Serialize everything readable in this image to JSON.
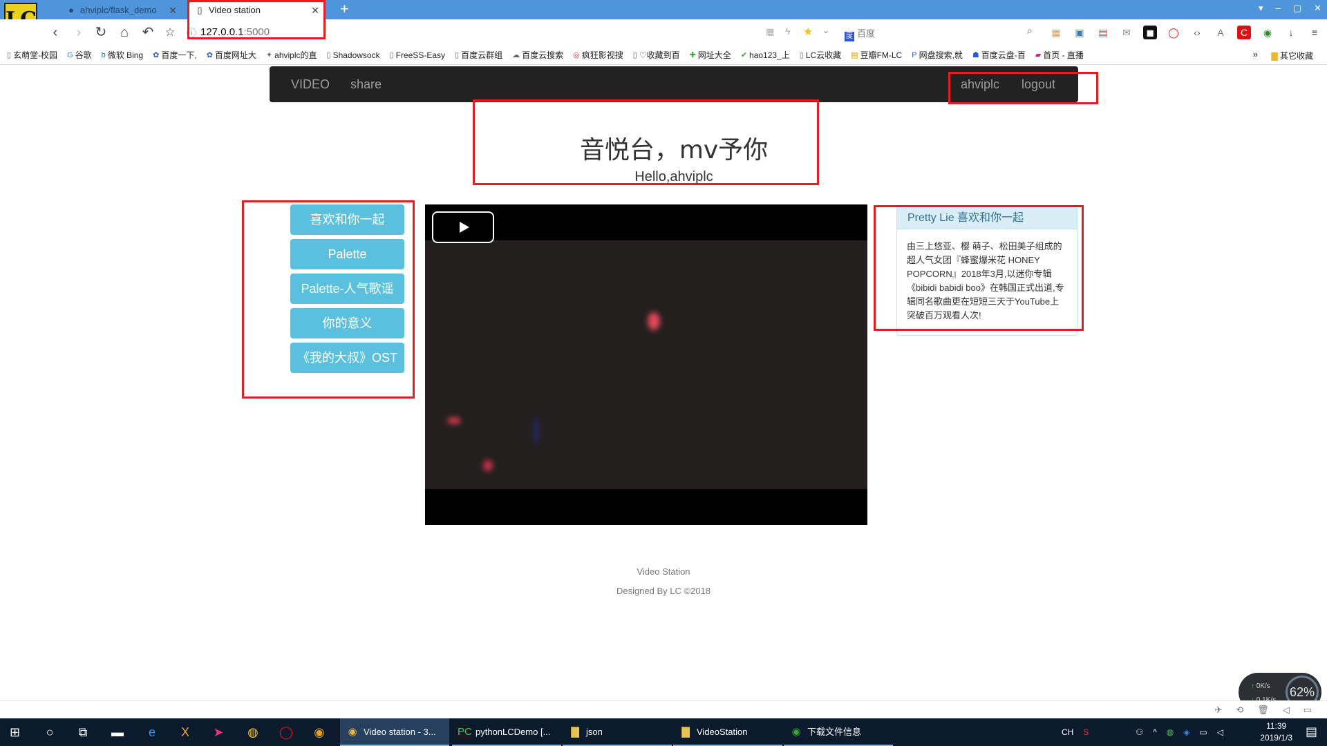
{
  "browser": {
    "tabs": [
      {
        "title": "ahviplc/flask_demo",
        "icon": "github-icon",
        "active": false
      },
      {
        "title": "Video station",
        "icon": "page-icon",
        "active": true
      }
    ],
    "new_tab": "+",
    "url_host": "127.0.0.1",
    "url_port": ":5000",
    "search_engine": "百度",
    "bookmarks": [
      "玄萌堂-校园",
      "谷歌",
      "微软 Bing",
      "百度一下,",
      "百度网址大",
      "ahviplc的直",
      "Shadowsock",
      "FreeSS-Easy",
      "百度云群组",
      "百度云搜索",
      "疯狂影视搜",
      "♡收藏到百",
      "网址大全",
      "hao123_上",
      "LC云收藏",
      "豆瓣FM-LC",
      "网盘搜索,就",
      "百度云盘-百",
      "首页 - 直播"
    ],
    "bookmarks_more": "»",
    "bookmarks_other": "其它收藏"
  },
  "site": {
    "nav_left": [
      "VIDEO",
      "share"
    ],
    "nav_right": [
      "ahviplc",
      "logout"
    ],
    "title": "音悦台，mv予你",
    "greeting": "Hello,ahviplc",
    "songs": [
      "喜欢和你一起",
      "Palette",
      "Palette-人气歌谣",
      "你的意义",
      "《我的大叔》OST"
    ],
    "panel_heading": "Pretty Lie 喜欢和你一起",
    "panel_body": "由三上悠亚、樱 萌子、松田美子组成的超人气女团『蜂蜜爆米花 HONEY POPCORN』2018年3月,以迷你专辑《bibidi babidi boo》在韩国正式出道,专辑同名歌曲更在短短三天于YouTube上突破百万观看人次!",
    "footer_title": "Video Station",
    "footer_credit": "Designed By LC ©2018"
  },
  "netmon": {
    "up": "0K/s",
    "down": "0.1K/s",
    "percent": "62%"
  },
  "taskbar": {
    "apps": [
      {
        "label": "Video station - 3...",
        "icon": "chrome-like-icon"
      },
      {
        "label": "pythonLCDemo [...",
        "icon": "pycharm-icon"
      },
      {
        "label": "json",
        "icon": "folder-icon"
      },
      {
        "label": "VideoStation",
        "icon": "folder-icon"
      },
      {
        "label": "下载文件信息",
        "icon": "download-icon"
      }
    ],
    "lang": "CH",
    "time": "11:39",
    "date": "2019/1/3"
  },
  "colors": {
    "accent_blue": "#5bc0de",
    "navbar_bg": "#222222",
    "annotation_red": "#e02020",
    "panel_head_bg": "#d9edf7"
  }
}
